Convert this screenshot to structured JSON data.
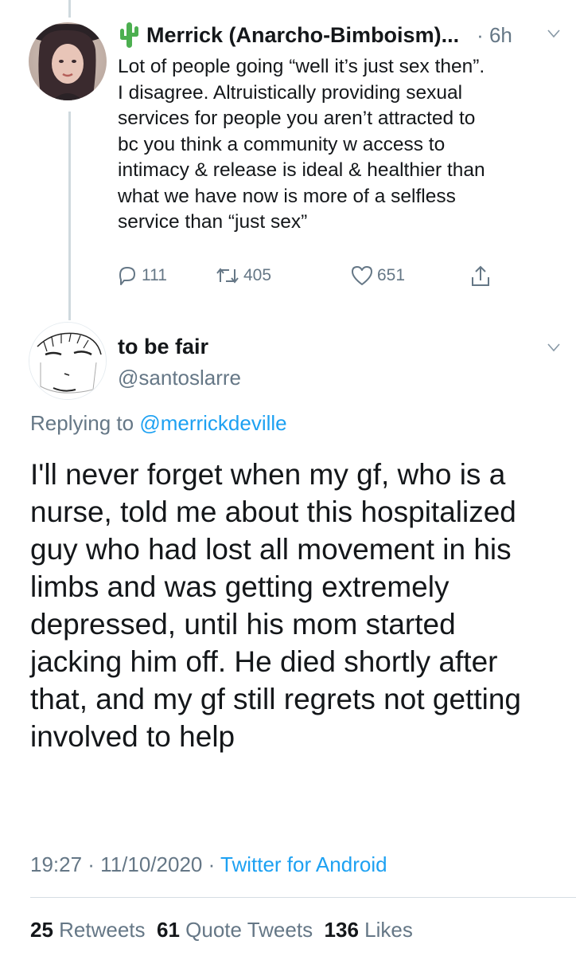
{
  "parent_tweet": {
    "author_name": "Merrick (Anarcho-Bimboism)...",
    "author_emoji_icon": "cactus-icon",
    "time": "· 6h",
    "text_lines": [
      "Lot of people going “well it’s just sex then”.",
      "I disagree. Altruistically providing sexual",
      "services for people you aren’t attracted to",
      "bc you think a community w access to",
      "intimacy & release is ideal & healthier than",
      "what we have now is more of a selfless",
      "service than “just sex”"
    ],
    "replies": "111",
    "retweets": "405",
    "likes": "651"
  },
  "tweet": {
    "author_name": "to be fair",
    "handle": "@santoslarre",
    "replying_prefix": "Replying to ",
    "replying_to": "@merrickdeville",
    "text_lines": [
      "I'll never forget when my gf, who is a",
      "nurse, told me about this hospitalized",
      "guy who had lost all movement in his",
      "limbs and was getting extremely",
      "depressed, until his mom started",
      "jacking him off. He died shortly after",
      "that, and my gf still regrets not getting",
      "involved to help"
    ],
    "timestamp": "19:27 · 11/10/2020 · ",
    "source": "Twitter for Android",
    "stats": {
      "retweets_count": "25",
      "retweets_label": " Retweets",
      "quotes_count": "61",
      "quotes_label": " Quote Tweets",
      "likes_count": "136",
      "likes_label": " Likes"
    }
  },
  "colors": {
    "link": "#1da1f2",
    "secondary_text": "#657786",
    "primary_text": "#14171a",
    "thread_line": "#cfd9de"
  }
}
